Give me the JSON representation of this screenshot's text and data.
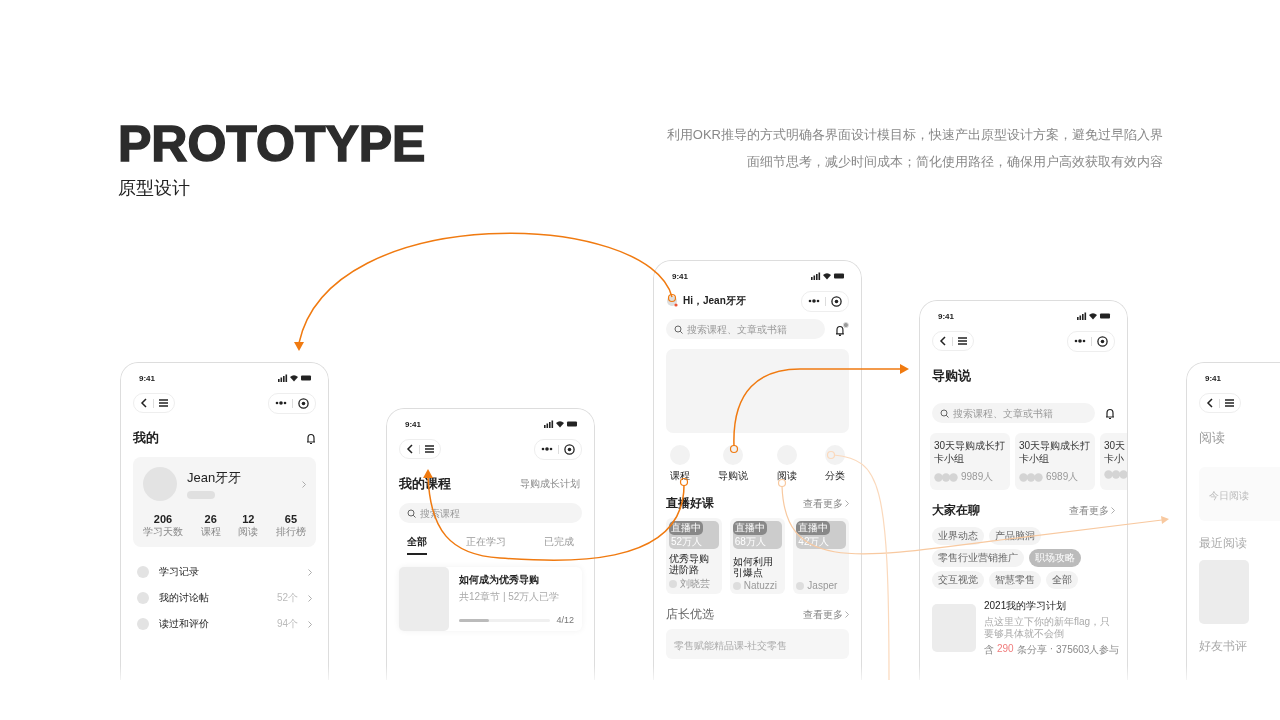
{
  "header": {
    "title": "PROTOTYPE",
    "subtitle": "原型设计",
    "description": [
      "利用OKR推导的方式明确各界面设计模目标，快速产出原型设计方案，避免过早陷入界",
      "面细节思考，减少时间成本；简化使用路径，确保用户高效获取有效内容"
    ]
  },
  "phones": [
    {
      "kind": "profile",
      "time": "9:41",
      "title": "我的",
      "user": "Jean牙牙",
      "stats": [
        {
          "value": "206",
          "label": "学习天数"
        },
        {
          "value": "26",
          "label": "课程"
        },
        {
          "value": "12",
          "label": "阅读"
        },
        {
          "value": "65",
          "label": "排行榜"
        }
      ],
      "menu": [
        {
          "label": "学习记录"
        },
        {
          "label": "我的讨论帖",
          "count": "52个"
        },
        {
          "label": "读过和评价",
          "count": "94个"
        }
      ]
    },
    {
      "kind": "courses",
      "time": "9:41",
      "title": "我的课程",
      "link": "导购成长计划",
      "search": {
        "placeholder": "搜索课程"
      },
      "tabs": [
        {
          "label": "全部",
          "selected": true
        },
        {
          "label": "正在学习",
          "selected": false
        },
        {
          "label": "已完成",
          "selected": false
        }
      ],
      "course": {
        "title": "如何成为优秀导购",
        "meta": "共12章节 | 52万人已学",
        "level": 0.33,
        "reading": "4/12"
      }
    },
    {
      "kind": "home",
      "time": "9:41",
      "greeting": "Hi，Jean牙牙",
      "search": {
        "placeholder": "搜索课程、文章或书籍"
      },
      "categories": [
        "课程",
        "导购说",
        "阅读",
        "分类"
      ],
      "live": {
        "title": "直播好课",
        "more": "查看更多",
        "cards": [
          {
            "badge": "直播中",
            "viewers": "52万人",
            "title": "优秀导购进阶路",
            "author": "刘晓芸"
          },
          {
            "badge": "直播中",
            "viewers": "68万人",
            "title": "如何利用引爆点",
            "author": "Natuzzi"
          },
          {
            "badge": "直播中",
            "viewers": "42万人",
            "author": "Jasper"
          }
        ]
      },
      "shop": {
        "title": "店长优选",
        "more": "查看更多",
        "item": "零售赋能精品课-社交零售"
      }
    },
    {
      "kind": "guide",
      "time": "9:41",
      "title": "导购说",
      "search": {
        "placeholder": "搜索课程、文章或书籍"
      },
      "groups": [
        {
          "lines": [
            "30天导购成长打",
            "卡小组"
          ],
          "count": "9989人"
        },
        {
          "lines": [
            "30天导购成长打",
            "卡小组"
          ],
          "count": "6989人"
        },
        {
          "lines": [
            "30天",
            "卡小"
          ]
        }
      ],
      "chat": {
        "title": "大家在聊",
        "more": "查看更多",
        "tags": [
          {
            "label": "业界动态",
            "selected": false
          },
          {
            "label": "产品脑洞",
            "selected": false
          },
          {
            "label": "零售行业营销推广",
            "selected": false
          },
          {
            "label": "职场攻略",
            "selected": true
          },
          {
            "label": "交互视觉",
            "selected": false
          },
          {
            "label": "智慧零售",
            "selected": false
          },
          {
            "label": "全部",
            "selected": false
          }
        ]
      },
      "post": {
        "title": "2021我的学习计划",
        "text": "点这里立下你的新年flag，只要够具体就不会倒",
        "prefix": "含",
        "count": "290",
        "suffix": "条分享",
        "separator": "·",
        "participants": "375603人参与"
      }
    },
    {
      "kind": "reading",
      "time": "9:41",
      "title": "阅读",
      "quote": "今日阅读",
      "section": "最近阅读",
      "friends": "好友书评"
    }
  ]
}
